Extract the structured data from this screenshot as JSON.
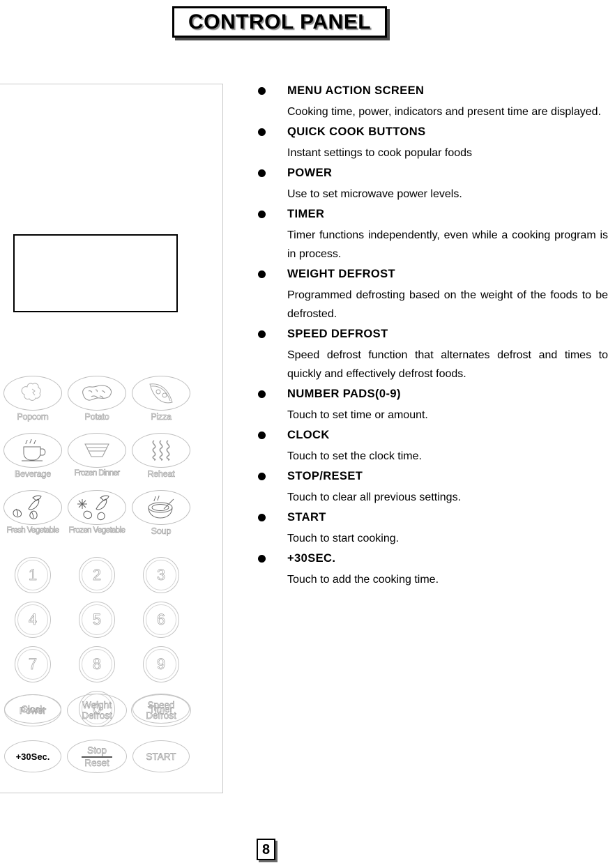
{
  "header": {
    "title": "CONTROL PANEL"
  },
  "page": {
    "number": "8"
  },
  "control_panel": {
    "display_screen_label": "menu-action-screen",
    "quick_cook_buttons": [
      {
        "label": "Popcorn",
        "icon": "popcorn-icon"
      },
      {
        "label": "Potato",
        "icon": "potato-icon"
      },
      {
        "label": "Pizza",
        "icon": "pizza-slice-icon"
      },
      {
        "label": "Beverage",
        "icon": "coffee-cup-icon"
      },
      {
        "label": "Frozen Dinner",
        "icon": "dinner-tray-icon"
      },
      {
        "label": "Reheat",
        "icon": "steam-waves-icon"
      },
      {
        "label": "Fresh Vegetable",
        "icon": "fresh-vegetable-icon"
      },
      {
        "label": "Frozen Vegetable",
        "icon": "frozen-vegetable-icon"
      },
      {
        "label": "Soup",
        "icon": "soup-bowl-icon"
      }
    ],
    "number_pad": [
      "1",
      "2",
      "3",
      "4",
      "5",
      "6",
      "7",
      "8",
      "9"
    ],
    "utility_row": [
      {
        "label": "Clock",
        "shape": "oval"
      },
      {
        "label": "0",
        "shape": "circle"
      },
      {
        "label": "Timer",
        "shape": "oval"
      }
    ],
    "function_keys": [
      {
        "line1": "Power",
        "line2": ""
      },
      {
        "line1": "Weight",
        "line2": "Defrost"
      },
      {
        "line1": "Speed",
        "line2": "Defrost"
      }
    ],
    "action_keys": [
      {
        "line1": "+30Sec.",
        "line2": ""
      },
      {
        "line1": "Stop",
        "line2": "Reset"
      },
      {
        "line1": "START",
        "line2": ""
      }
    ]
  },
  "descriptions": [
    {
      "title": "MENU ACTION SCREEN",
      "body": "Cooking time, power, indicators and present time are displayed."
    },
    {
      "title": "QUICK COOK BUTTONS",
      "body": "Instant settings to cook popular foods"
    },
    {
      "title": "POWER",
      "body": "Use to set microwave power levels."
    },
    {
      "title": "TIMER",
      "body": "Timer functions independently, even while a cooking program is in process."
    },
    {
      "title": "WEIGHT DEFROST",
      "body": "Programmed defrosting based on the weight of the foods to be defrosted."
    },
    {
      "title": "SPEED DEFROST",
      "body": "Speed defrost function that alternates defrost and times to quickly and effectively defrost foods."
    },
    {
      "title": "NUMBER PADS(0-9)",
      "body": "Touch to set time or amount."
    },
    {
      "title": "CLOCK",
      "body": "Touch to set the clock time."
    },
    {
      "title": "STOP/RESET",
      "body": "Touch to clear all previous settings."
    },
    {
      "title": "START",
      "body": "Touch to start cooking."
    },
    {
      "title": "+30SEC.",
      "body": "Touch to add the cooking time."
    }
  ],
  "colors": {
    "ink": "#000000",
    "panel_outline": "#c9c9c9",
    "key_outline": "#c4c4c4"
  }
}
